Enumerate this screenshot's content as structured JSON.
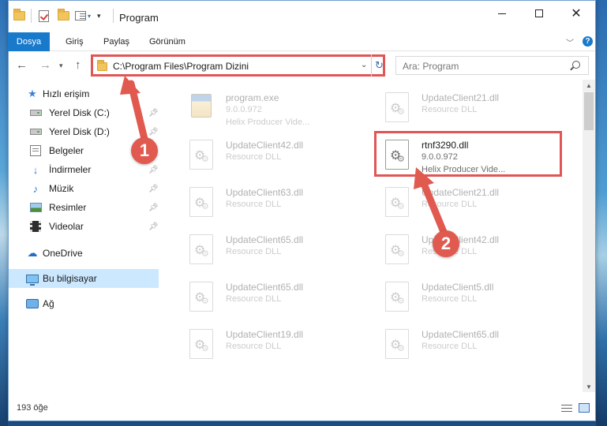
{
  "window": {
    "title": "Program"
  },
  "ribbon": {
    "tabs": [
      "Dosya",
      "Giriş",
      "Paylaş",
      "Görünüm"
    ],
    "help": "?"
  },
  "nav": {
    "address": "C:\\Program Files\\Program Dizini",
    "search_placeholder": "Ara: Program"
  },
  "sidebar": {
    "quick_access": "Hızlı erişim",
    "items": [
      {
        "label": "Yerel Disk (C:)",
        "icon": "drive-icon",
        "pinned": true
      },
      {
        "label": "Yerel Disk (D:)",
        "icon": "drive-icon",
        "pinned": true
      },
      {
        "label": "Belgeler",
        "icon": "documents-icon",
        "pinned": true
      },
      {
        "label": "İndirmeler",
        "icon": "download-icon",
        "pinned": true
      },
      {
        "label": "Müzik",
        "icon": "music-icon",
        "pinned": true
      },
      {
        "label": "Resimler",
        "icon": "pictures-icon",
        "pinned": true
      },
      {
        "label": "Videolar",
        "icon": "videos-icon",
        "pinned": true
      }
    ],
    "onedrive": "OneDrive",
    "this_pc": "Bu bilgisayar",
    "network": "Ağ"
  },
  "files": [
    {
      "name": "program.exe",
      "line2": "9.0.0.972",
      "line3": "Helix Producer Vide...",
      "kind": "exe",
      "highlighted": false
    },
    {
      "name": "UpdateClient21.dll",
      "line2": "Resource DLL",
      "line3": "",
      "kind": "dll",
      "highlighted": false
    },
    {
      "name": "UpdateClient42.dll",
      "line2": "Resource DLL",
      "line3": "",
      "kind": "dll",
      "highlighted": false
    },
    {
      "name": "rtnf3290.dll",
      "line2": "9.0.0.972",
      "line3": "Helix Producer Vide...",
      "kind": "dll",
      "highlighted": true
    },
    {
      "name": "UpdateClient63.dll",
      "line2": "Resource DLL",
      "line3": "",
      "kind": "dll",
      "highlighted": false
    },
    {
      "name": "UpdateClient21.dll",
      "line2": "Resource DLL",
      "line3": "",
      "kind": "dll",
      "highlighted": false
    },
    {
      "name": "UpdateClient65.dll",
      "line2": "Resource DLL",
      "line3": "",
      "kind": "dll",
      "highlighted": false
    },
    {
      "name": "UpdateClient42.dll",
      "line2": "Resource DLL",
      "line3": "",
      "kind": "dll",
      "highlighted": false
    },
    {
      "name": "UpdateClient65.dll",
      "line2": "Resource DLL",
      "line3": "",
      "kind": "dll",
      "highlighted": false
    },
    {
      "name": "UpdateClient5.dll",
      "line2": "Resource DLL",
      "line3": "",
      "kind": "dll",
      "highlighted": false
    },
    {
      "name": "UpdateClient19.dll",
      "line2": "Resource DLL",
      "line3": "",
      "kind": "dll",
      "highlighted": false
    },
    {
      "name": "UpdateClient65.dll",
      "line2": "Resource DLL",
      "line3": "",
      "kind": "dll",
      "highlighted": false
    }
  ],
  "status": {
    "count": "193 öğe"
  },
  "annotations": {
    "step1": "1",
    "step2": "2",
    "color": "#e05a4f"
  }
}
